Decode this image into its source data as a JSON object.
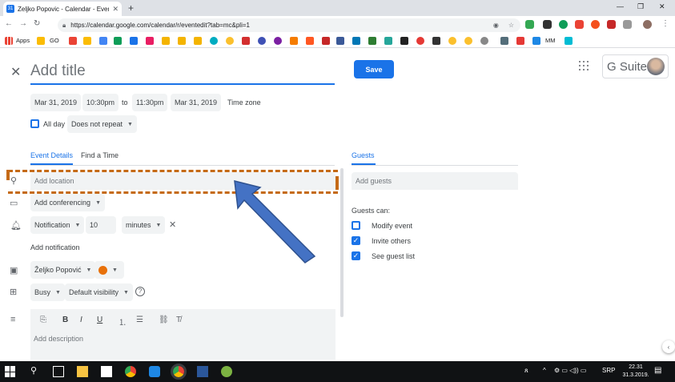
{
  "browser": {
    "tab_title": "Zeljko Popovic - Calendar - Event",
    "tab_favicon": "31",
    "url": "https://calendar.google.com/calendar/r/eventedit?tab=mc&pli=1",
    "bookmarks": [
      {
        "label": "Apps"
      },
      {
        "label": "GO"
      },
      {
        "label": "MM"
      }
    ]
  },
  "event": {
    "title_placeholder": "Add title",
    "save_label": "Save",
    "start_date": "Mar 31, 2019",
    "start_time": "10:30pm",
    "to_label": "to",
    "end_time": "11:30pm",
    "end_date": "Mar 31, 2019",
    "timezone_label": "Time zone",
    "allday_label": "All day",
    "repeat_value": "Does not repeat"
  },
  "gsuite": {
    "label": "G Suite"
  },
  "tabs": {
    "details": "Event Details",
    "find_time": "Find a Time"
  },
  "details": {
    "location_placeholder": "Add location",
    "conferencing_label": "Add conferencing",
    "notification_type": "Notification",
    "notification_value": "10",
    "notification_unit": "minutes",
    "add_notification": "Add notification",
    "calendar_owner": "Željko Popović",
    "busy_value": "Busy",
    "visibility_value": "Default visibility",
    "description_placeholder": "Add description"
  },
  "guests": {
    "heading": "Guests",
    "add_placeholder": "Add guests",
    "can_label": "Guests can:",
    "permissions": [
      {
        "label": "Modify event",
        "checked": false
      },
      {
        "label": "Invite others",
        "checked": true
      },
      {
        "label": "See guest list",
        "checked": true
      }
    ]
  },
  "taskbar": {
    "lang": "SRP",
    "time": "22.31",
    "date": "31.3.2019."
  },
  "colors": {
    "accent": "#1a73e8",
    "annotation": "#c56a16",
    "arrow": "#4472c4",
    "event_color": "#e8710a"
  }
}
